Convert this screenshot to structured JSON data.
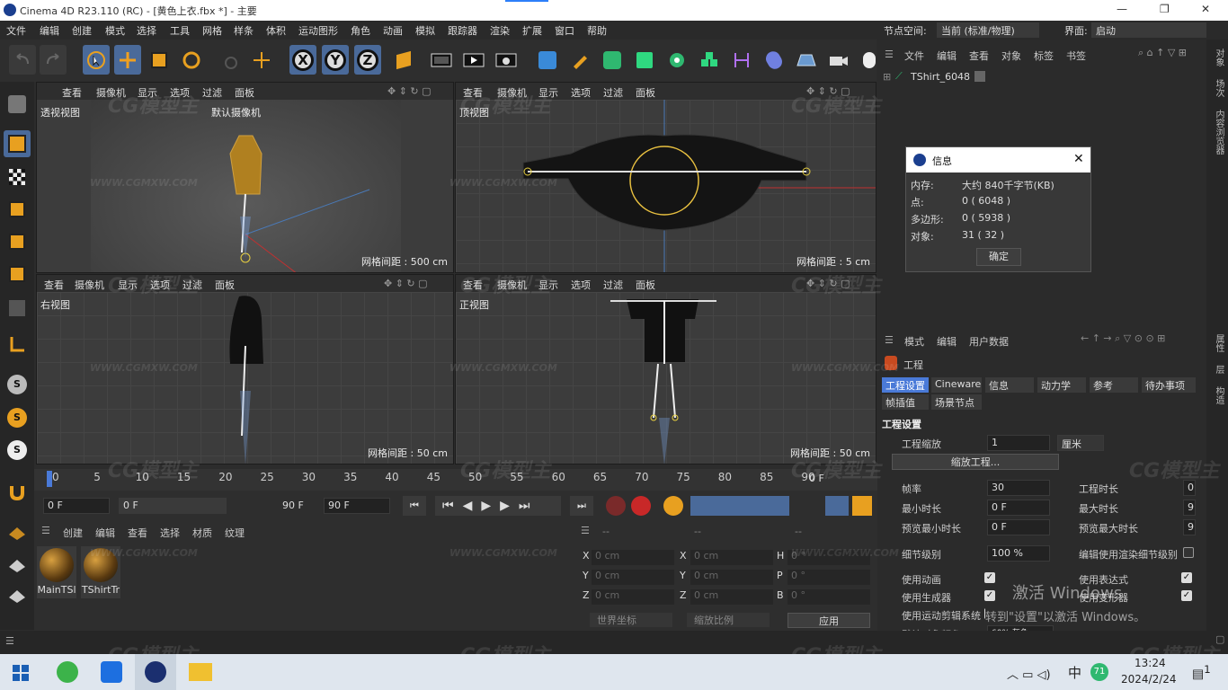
{
  "window": {
    "title": "Cinema 4D R23.110 (RC) - [黄色上衣.fbx *] - 主要"
  },
  "menu": [
    "文件",
    "编辑",
    "创建",
    "模式",
    "选择",
    "工具",
    "网格",
    "样条",
    "体积",
    "运动图形",
    "角色",
    "动画",
    "模拟",
    "跟踪器",
    "渲染",
    "扩展",
    "窗口",
    "帮助"
  ],
  "layout": {
    "node_space_label": "节点空间:",
    "node_space_value": "当前 (标准/物理)",
    "interface_label": "界面:",
    "interface_value": "启动"
  },
  "viewport_menu": [
    "查看",
    "摄像机",
    "显示",
    "选项",
    "过滤",
    "面板"
  ],
  "viewports": [
    {
      "name": "透视视图",
      "camera": "默认摄像机",
      "grid": "网格间距 : 500 cm"
    },
    {
      "name": "顶视图",
      "grid": "网格间距 : 5 cm"
    },
    {
      "name": "右视图",
      "grid": "网格间距 : 50 cm"
    },
    {
      "name": "正视图",
      "grid": "网格间距 : 50 cm"
    }
  ],
  "timeline": {
    "ticks": [
      "0",
      "5",
      "10",
      "15",
      "20",
      "25",
      "30",
      "35",
      "40",
      "45",
      "50",
      "55",
      "60",
      "65",
      "70",
      "75",
      "80",
      "85",
      "90"
    ],
    "end_label": "0 F"
  },
  "controls": {
    "current": "0 F",
    "range_start": "0 F",
    "range_end": "90 F",
    "max": "90 F"
  },
  "material_menu": [
    "创建",
    "编辑",
    "查看",
    "选择",
    "材质",
    "纹理"
  ],
  "materials": [
    {
      "name": "MainTSl"
    },
    {
      "name": "TShirtTr"
    }
  ],
  "coords": {
    "header": [
      "--",
      "--",
      "--"
    ],
    "rows": [
      {
        "a": "X",
        "av": "0 cm",
        "b": "X",
        "bv": "0 cm",
        "c": "H",
        "cv": "0 °"
      },
      {
        "a": "Y",
        "av": "0 cm",
        "b": "Y",
        "bv": "0 cm",
        "c": "P",
        "cv": "0 °"
      },
      {
        "a": "Z",
        "av": "0 cm",
        "b": "Z",
        "bv": "0 cm",
        "c": "B",
        "cv": "0 °"
      }
    ],
    "world": "世界坐标",
    "scale": "缩放比例",
    "apply": "应用"
  },
  "objects": {
    "menu": [
      "文件",
      "编辑",
      "查看",
      "对象",
      "标签",
      "书签"
    ],
    "items": [
      {
        "name": "TShirt_6048"
      }
    ]
  },
  "info_dialog": {
    "title": "信息",
    "rows": [
      {
        "k": "内存:",
        "v": "大约 840千字节(KB)"
      },
      {
        "k": "点:",
        "v": "0 ( 6048 )"
      },
      {
        "k": "多边形:",
        "v": "0 ( 5938 )"
      },
      {
        "k": "对象:",
        "v": "31 ( 32 )"
      }
    ],
    "ok": "确定"
  },
  "attributes": {
    "menu": [
      "模式",
      "编辑",
      "用户数据"
    ],
    "title": "工程",
    "tabs": [
      "工程设置",
      "Cineware",
      "信息",
      "动力学",
      "参考",
      "待办事项",
      "帧插值",
      "场景节点"
    ],
    "section": "工程设置",
    "scale_label": "工程缩放",
    "scale_value": "1",
    "scale_unit": "厘米",
    "scale_btn": "缩放工程...",
    "fps_label": "帧率",
    "fps_value": "30",
    "proj_len_label": "工程时长",
    "proj_len_value": "0",
    "min_label": "最小时长",
    "min_value": "0 F",
    "max_label": "最大时长",
    "max_value": "9",
    "pmin_label": "预览最小时长",
    "pmin_value": "0 F",
    "pmax_label": "预览最大时长",
    "pmax_value": "9",
    "lod_label": "细节级别",
    "lod_value": "100 %",
    "render_lod_label": "编辑使用渲染细节级别",
    "checks": [
      {
        "label": "使用动画"
      },
      {
        "label": "使用表达式"
      },
      {
        "label": "使用生成器"
      },
      {
        "label": "使用变形器"
      },
      {
        "label": "使用运动剪辑系统"
      }
    ],
    "default_color_label": "默认对象颜色",
    "default_color_value": "60% 灰色"
  },
  "activation": {
    "line1": "激活 Windows",
    "line2": "转到\"设置\"以激活 Windows。"
  },
  "side": [
    "对象",
    "场次",
    "内容浏览器",
    "属性",
    "层",
    "构造"
  ],
  "watermark": {
    "brand": "CG模型主",
    "url": "WWW.CGMXW.COM"
  },
  "taskbar": {
    "time": "13:24",
    "date": "2024/2/24",
    "lang": "中",
    "badge": "71",
    "notif": "1"
  }
}
